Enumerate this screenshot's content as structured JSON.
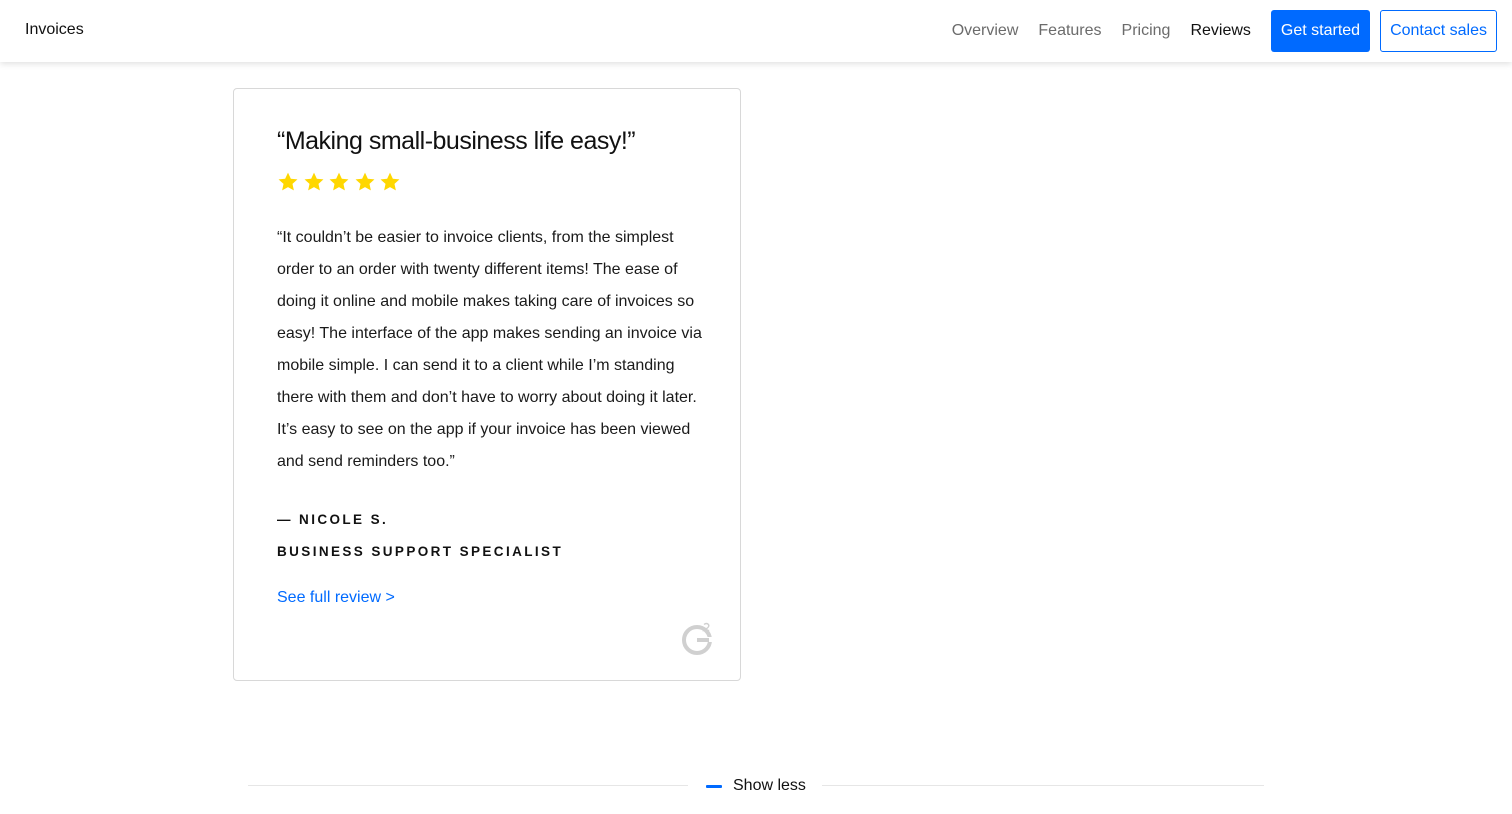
{
  "header": {
    "brand": "Invoices",
    "nav": [
      {
        "label": "Overview",
        "active": false
      },
      {
        "label": "Features",
        "active": false
      },
      {
        "label": "Pricing",
        "active": false
      },
      {
        "label": "Reviews",
        "active": true
      }
    ],
    "cta_primary": "Get started",
    "cta_secondary": "Contact sales"
  },
  "review": {
    "title": "“Making small-business life easy!”",
    "rating": 5,
    "rating_max": 5,
    "star_color": "#ffd700",
    "body": "“It couldn’t be easier to invoice clients, from the simplest order to an order with twenty different items! The ease of doing it online and mobile makes taking care of invoices so easy! The interface of the app makes sending an invoice via mobile simple. I can send it to a client while I’m standing there with them and don’t have to worry about doing it later. It’s easy to see on the app if your invoice has been viewed and send reminders too.”",
    "author": "— NICOLE S.",
    "role": "BUSINESS SUPPORT SPECIALIST",
    "link_label": "See full review >",
    "source_icon": "g2-logo-icon"
  },
  "footer": {
    "toggle_label": "Show less",
    "toggle_icon": "minus-icon"
  },
  "colors": {
    "accent": "#006aff"
  }
}
